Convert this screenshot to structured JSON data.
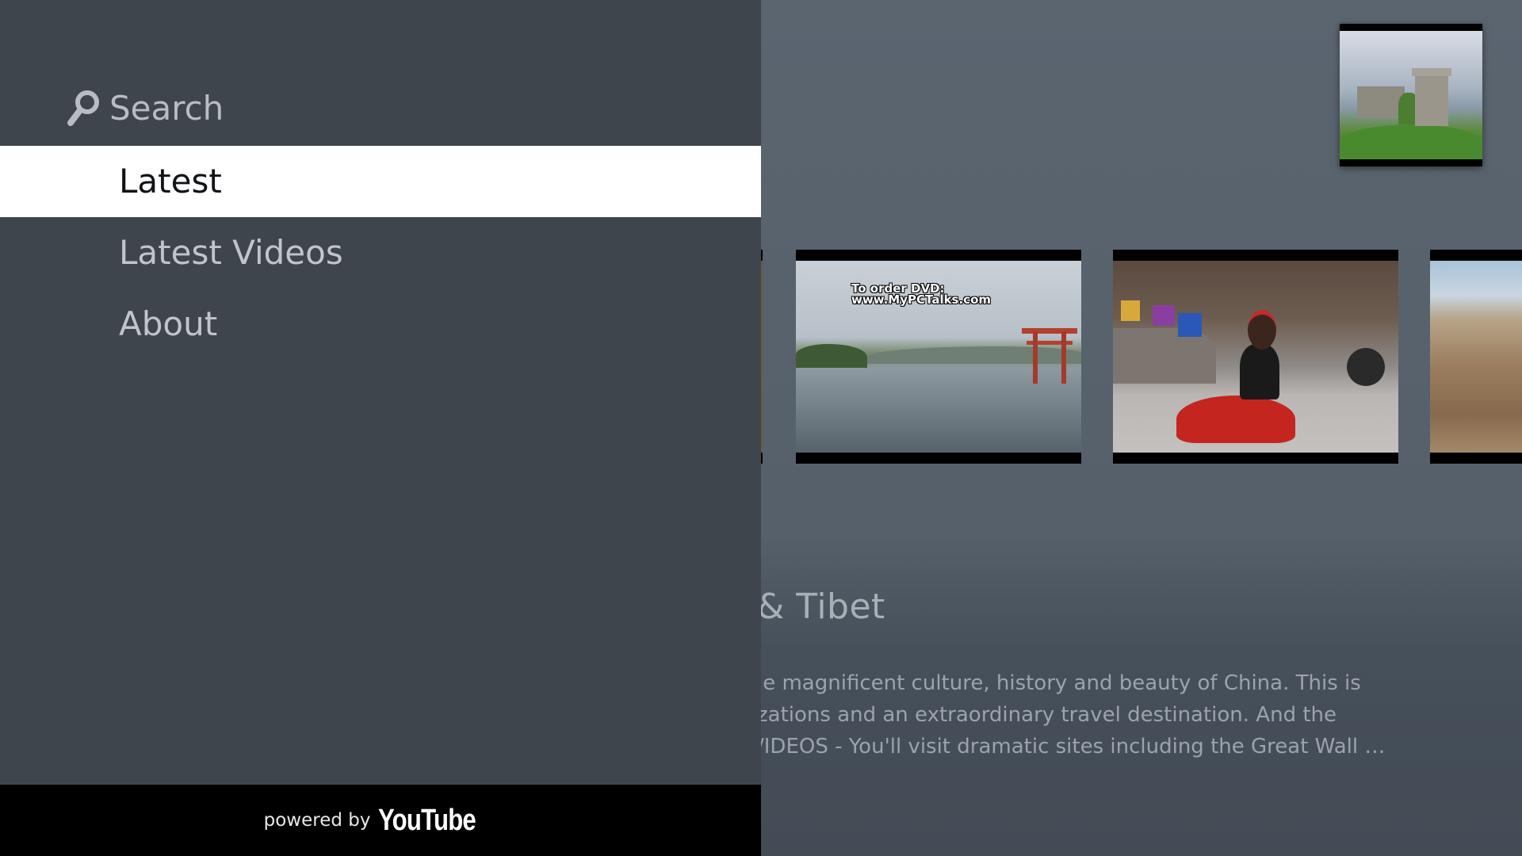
{
  "drawer": {
    "search_label": "Search",
    "items": [
      {
        "label": "Latest",
        "selected": true
      },
      {
        "label": "Latest Videos",
        "selected": false
      },
      {
        "label": "About",
        "selected": false
      }
    ],
    "footer": {
      "powered_by": "powered by",
      "brand": "YouTube"
    }
  },
  "main": {
    "thumbnails": [
      {
        "overlay_text": [
          "To order DVD:",
          "www.MyPCTalks.com"
        ]
      }
    ],
    "detail": {
      "title": "& Tibet",
      "description_lines": [
        "ıe magnificent culture, history and beauty of China. This is",
        "zations and an extraordinary travel destination. And the",
        "/IDEOS - You'll visit dramatic sites including the Great Wall …"
      ]
    }
  },
  "colors": {
    "drawer_bg": "#3f454d",
    "selected_bg": "#ffffff",
    "footer_bg": "#000000",
    "main_bg": "#5b6570"
  },
  "icons": {
    "search": "search-icon"
  }
}
